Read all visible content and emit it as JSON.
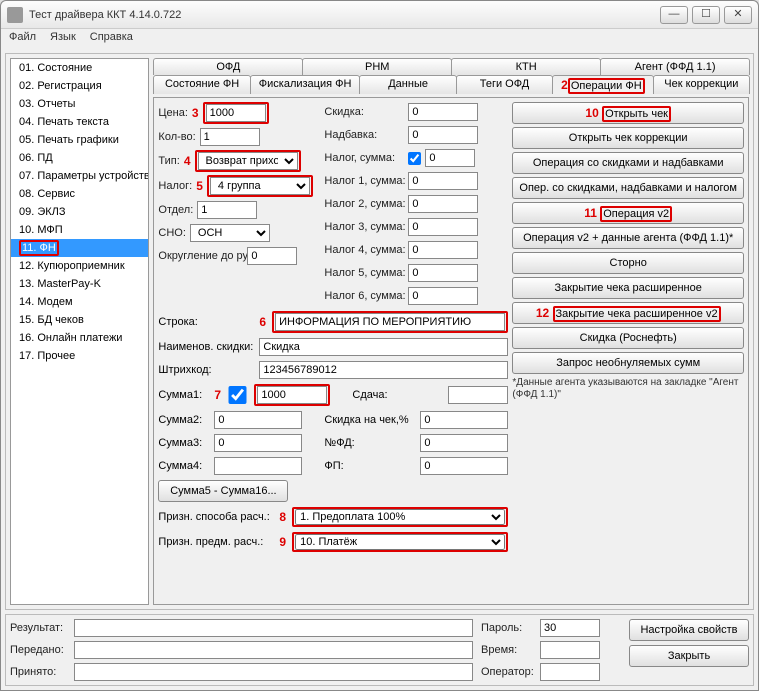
{
  "window": {
    "title": "Тест драйвера ККТ 4.14.0.722"
  },
  "menu": [
    "Файл",
    "Язык",
    "Справка"
  ],
  "sidebar": {
    "items": [
      "01. Состояние",
      "02. Регистрация",
      "03. Отчеты",
      "04. Печать текста",
      "05. Печать графики",
      "06. ПД",
      "07. Параметры устройства",
      "08. Сервис",
      "09. ЭКЛЗ",
      "10. МФП",
      "11. ФН",
      "12. Купюроприемник",
      "13. MasterPay-K",
      "14. Модем",
      "15. БД чеков",
      "16. Онлайн платежи",
      "17. Прочее"
    ],
    "selected": 10
  },
  "tabs": {
    "row1": [
      "ОФД",
      "РНМ",
      "КТН",
      "Агент (ФФД 1.1)"
    ],
    "row2": [
      "Состояние ФН",
      "Фискализация ФН",
      "Данные",
      "Теги ОФД",
      "Операции ФН",
      "Чек коррекции"
    ],
    "active": "Операции ФН"
  },
  "left": {
    "price_label": "Цена:",
    "price": "1000",
    "qty_label": "Кол-во:",
    "qty": "1",
    "type_label": "Тип:",
    "type": "Возврат приход",
    "tax_label": "Налог:",
    "tax": "4 группа",
    "dept_label": "Отдел:",
    "dept": "1",
    "sno_label": "СНО:",
    "sno": "ОСН",
    "round_label": "Округление до рубля, коп.:",
    "round": "0",
    "string_label": "Строка:",
    "string": "ИНФОРМАЦИЯ ПО МЕРОПРИЯТИЮ",
    "discname_label": "Наименов. скидки:",
    "discname": "Скидка",
    "barcode_label": "Штрихкод:",
    "barcode": "123456789012",
    "sum1_label": "Сумма1:",
    "sum1": "1000",
    "sum2_label": "Сумма2:",
    "sum2": "0",
    "sum3_label": "Сумма3:",
    "sum3": "0",
    "sum4_label": "Сумма4:",
    "sum4": "",
    "sums_btn": "Сумма5 - Сумма16..."
  },
  "mid": {
    "discount_label": "Скидка:",
    "discount": "0",
    "addon_label": "Надбавка:",
    "addon": "0",
    "taxsum_label": "Налог, сумма:",
    "taxsum": "0",
    "tax1_label": "Налог 1, сумма:",
    "tax1": "0",
    "tax2_label": "Налог 2, сумма:",
    "tax2": "0",
    "tax3_label": "Налог 3, сумма:",
    "tax3": "0",
    "tax4_label": "Налог 4, сумма:",
    "tax4": "0",
    "tax5_label": "Налог 5, сумма:",
    "tax5": "0",
    "tax6_label": "Налог 6, сумма:",
    "tax6": "0",
    "change_label": "Сдача:",
    "change": "",
    "chkdisc_label": "Скидка на чек,%",
    "chkdisc": "0",
    "fd_label": "№ФД:",
    "fd": "0",
    "fp_label": "ФП:",
    "fp": "0",
    "paymethod_label": "Призн. способа расч.:",
    "paymethod": "1. Предоплата 100%",
    "paysubj_label": "Призн. предм. расч.:",
    "paysubj": "10. Платёж"
  },
  "right": {
    "buttons": [
      "Открыть чек",
      "Открыть чек коррекции",
      "Операция со скидками и надбавками",
      "Опер. со скидками, надбавками и налогом",
      "Операция v2",
      "Операция v2 + данные агента (ФФД 1.1)*",
      "Сторно",
      "Закрытие чека расширенное",
      "Закрытие чека расширенное v2",
      "Скидка (Роснефть)",
      "Запрос необнуляемых сумм"
    ],
    "note": "*Данные агента указываются на закладке \"Агент (ФФД 1.1)\""
  },
  "footer": {
    "result_label": "Результат:",
    "result": "",
    "sent_label": "Передано:",
    "sent": "",
    "recv_label": "Принято:",
    "recv": "",
    "pwd_label": "Пароль:",
    "pwd": "30",
    "time_label": "Время:",
    "time": "",
    "oper_label": "Оператор:",
    "oper": "",
    "props_btn": "Настройка свойств",
    "close_btn": "Закрыть"
  },
  "ann": {
    "n2": "2",
    "n3": "3",
    "n4": "4",
    "n5": "5",
    "n6": "6",
    "n7": "7",
    "n8": "8",
    "n9": "9",
    "n10": "10",
    "n11": "11",
    "n12": "12"
  }
}
